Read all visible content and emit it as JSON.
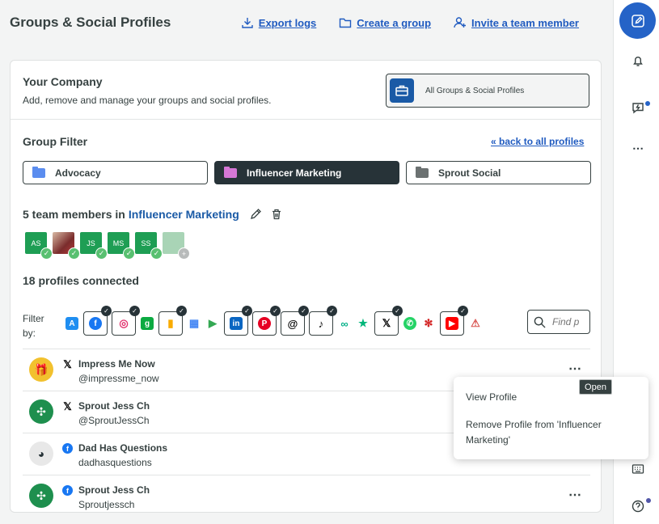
{
  "header": {
    "title": "Groups & Social Profiles",
    "export_logs": "Export logs",
    "create_group": "Create a group",
    "invite_member": "Invite a team member"
  },
  "company": {
    "title": "Your Company",
    "description": "Add, remove and manage your groups and social profiles.",
    "all_groups_label": "All Groups & Social Profiles"
  },
  "group_filter": {
    "title": "Group Filter",
    "back_link": "« back to all profiles",
    "groups": [
      {
        "label": "Advocacy",
        "color": "#5b8def",
        "active": false
      },
      {
        "label": "Influencer Marketing",
        "color": "#d677d6",
        "active": true
      },
      {
        "label": "Sprout Social",
        "color": "#6b7171",
        "active": false
      }
    ]
  },
  "team": {
    "prefix": "5 team members in",
    "group_name": "Influencer Marketing",
    "members": [
      {
        "initials": "AS",
        "kind": "initials"
      },
      {
        "initials": "",
        "kind": "photo"
      },
      {
        "initials": "JS",
        "kind": "initials"
      },
      {
        "initials": "MS",
        "kind": "initials"
      },
      {
        "initials": "SS",
        "kind": "initials"
      },
      {
        "initials": "",
        "kind": "add"
      }
    ]
  },
  "profiles_count": "18 profiles connected",
  "filter": {
    "label": "Filter by:",
    "search_placeholder": "Find p",
    "networks": [
      {
        "icon": "app-store-icon",
        "selected": false,
        "color": "#1f8ef1"
      },
      {
        "icon": "facebook-icon",
        "selected": true,
        "color": "#1877f2"
      },
      {
        "icon": "instagram-icon",
        "selected": true,
        "color": "#e1306c"
      },
      {
        "icon": "glassdoor-icon",
        "selected": false,
        "color": "#0caa41"
      },
      {
        "icon": "google-analytics-icon",
        "selected": true,
        "color": "#f9ab00"
      },
      {
        "icon": "google-business-icon",
        "selected": false,
        "color": "#4285f4"
      },
      {
        "icon": "google-play-icon",
        "selected": false,
        "color": "#34a853"
      },
      {
        "icon": "linkedin-icon",
        "selected": true,
        "color": "#0a66c2"
      },
      {
        "icon": "pinterest-icon",
        "selected": true,
        "color": "#e60023"
      },
      {
        "icon": "threads-icon",
        "selected": true,
        "color": "#000000"
      },
      {
        "icon": "tiktok-icon",
        "selected": true,
        "color": "#000000"
      },
      {
        "icon": "tripadvisor-icon",
        "selected": false,
        "color": "#00af87"
      },
      {
        "icon": "trustpilot-icon",
        "selected": false,
        "color": "#00b67a"
      },
      {
        "icon": "x-icon",
        "selected": true,
        "color": "#000000"
      },
      {
        "icon": "whatsapp-icon",
        "selected": false,
        "color": "#25d366"
      },
      {
        "icon": "yelp-icon",
        "selected": false,
        "color": "#d32323"
      },
      {
        "icon": "youtube-icon",
        "selected": true,
        "color": "#ff0000"
      },
      {
        "icon": "alert-icon",
        "selected": false,
        "color": "#d9534f"
      }
    ]
  },
  "profiles": [
    {
      "name": "Impress Me Now",
      "handle": "@impressme_now",
      "network": "x-icon",
      "avatar": "gift-avatar"
    },
    {
      "name": "Sprout Jess Ch",
      "handle": "@SproutJessCh",
      "network": "x-icon",
      "avatar": "sprout-avatar"
    },
    {
      "name": "Dad Has Questions",
      "handle": "dadhasquestions",
      "network": "facebook-icon",
      "avatar": "head-avatar"
    },
    {
      "name": "Sprout Jess Ch",
      "handle": "Sproutjessch",
      "network": "facebook-icon",
      "avatar": "sprout-avatar"
    }
  ],
  "menu": {
    "view_profile": "View Profile",
    "remove_profile": "Remove Profile from 'Influencer Marketing'",
    "tooltip": "Open"
  }
}
